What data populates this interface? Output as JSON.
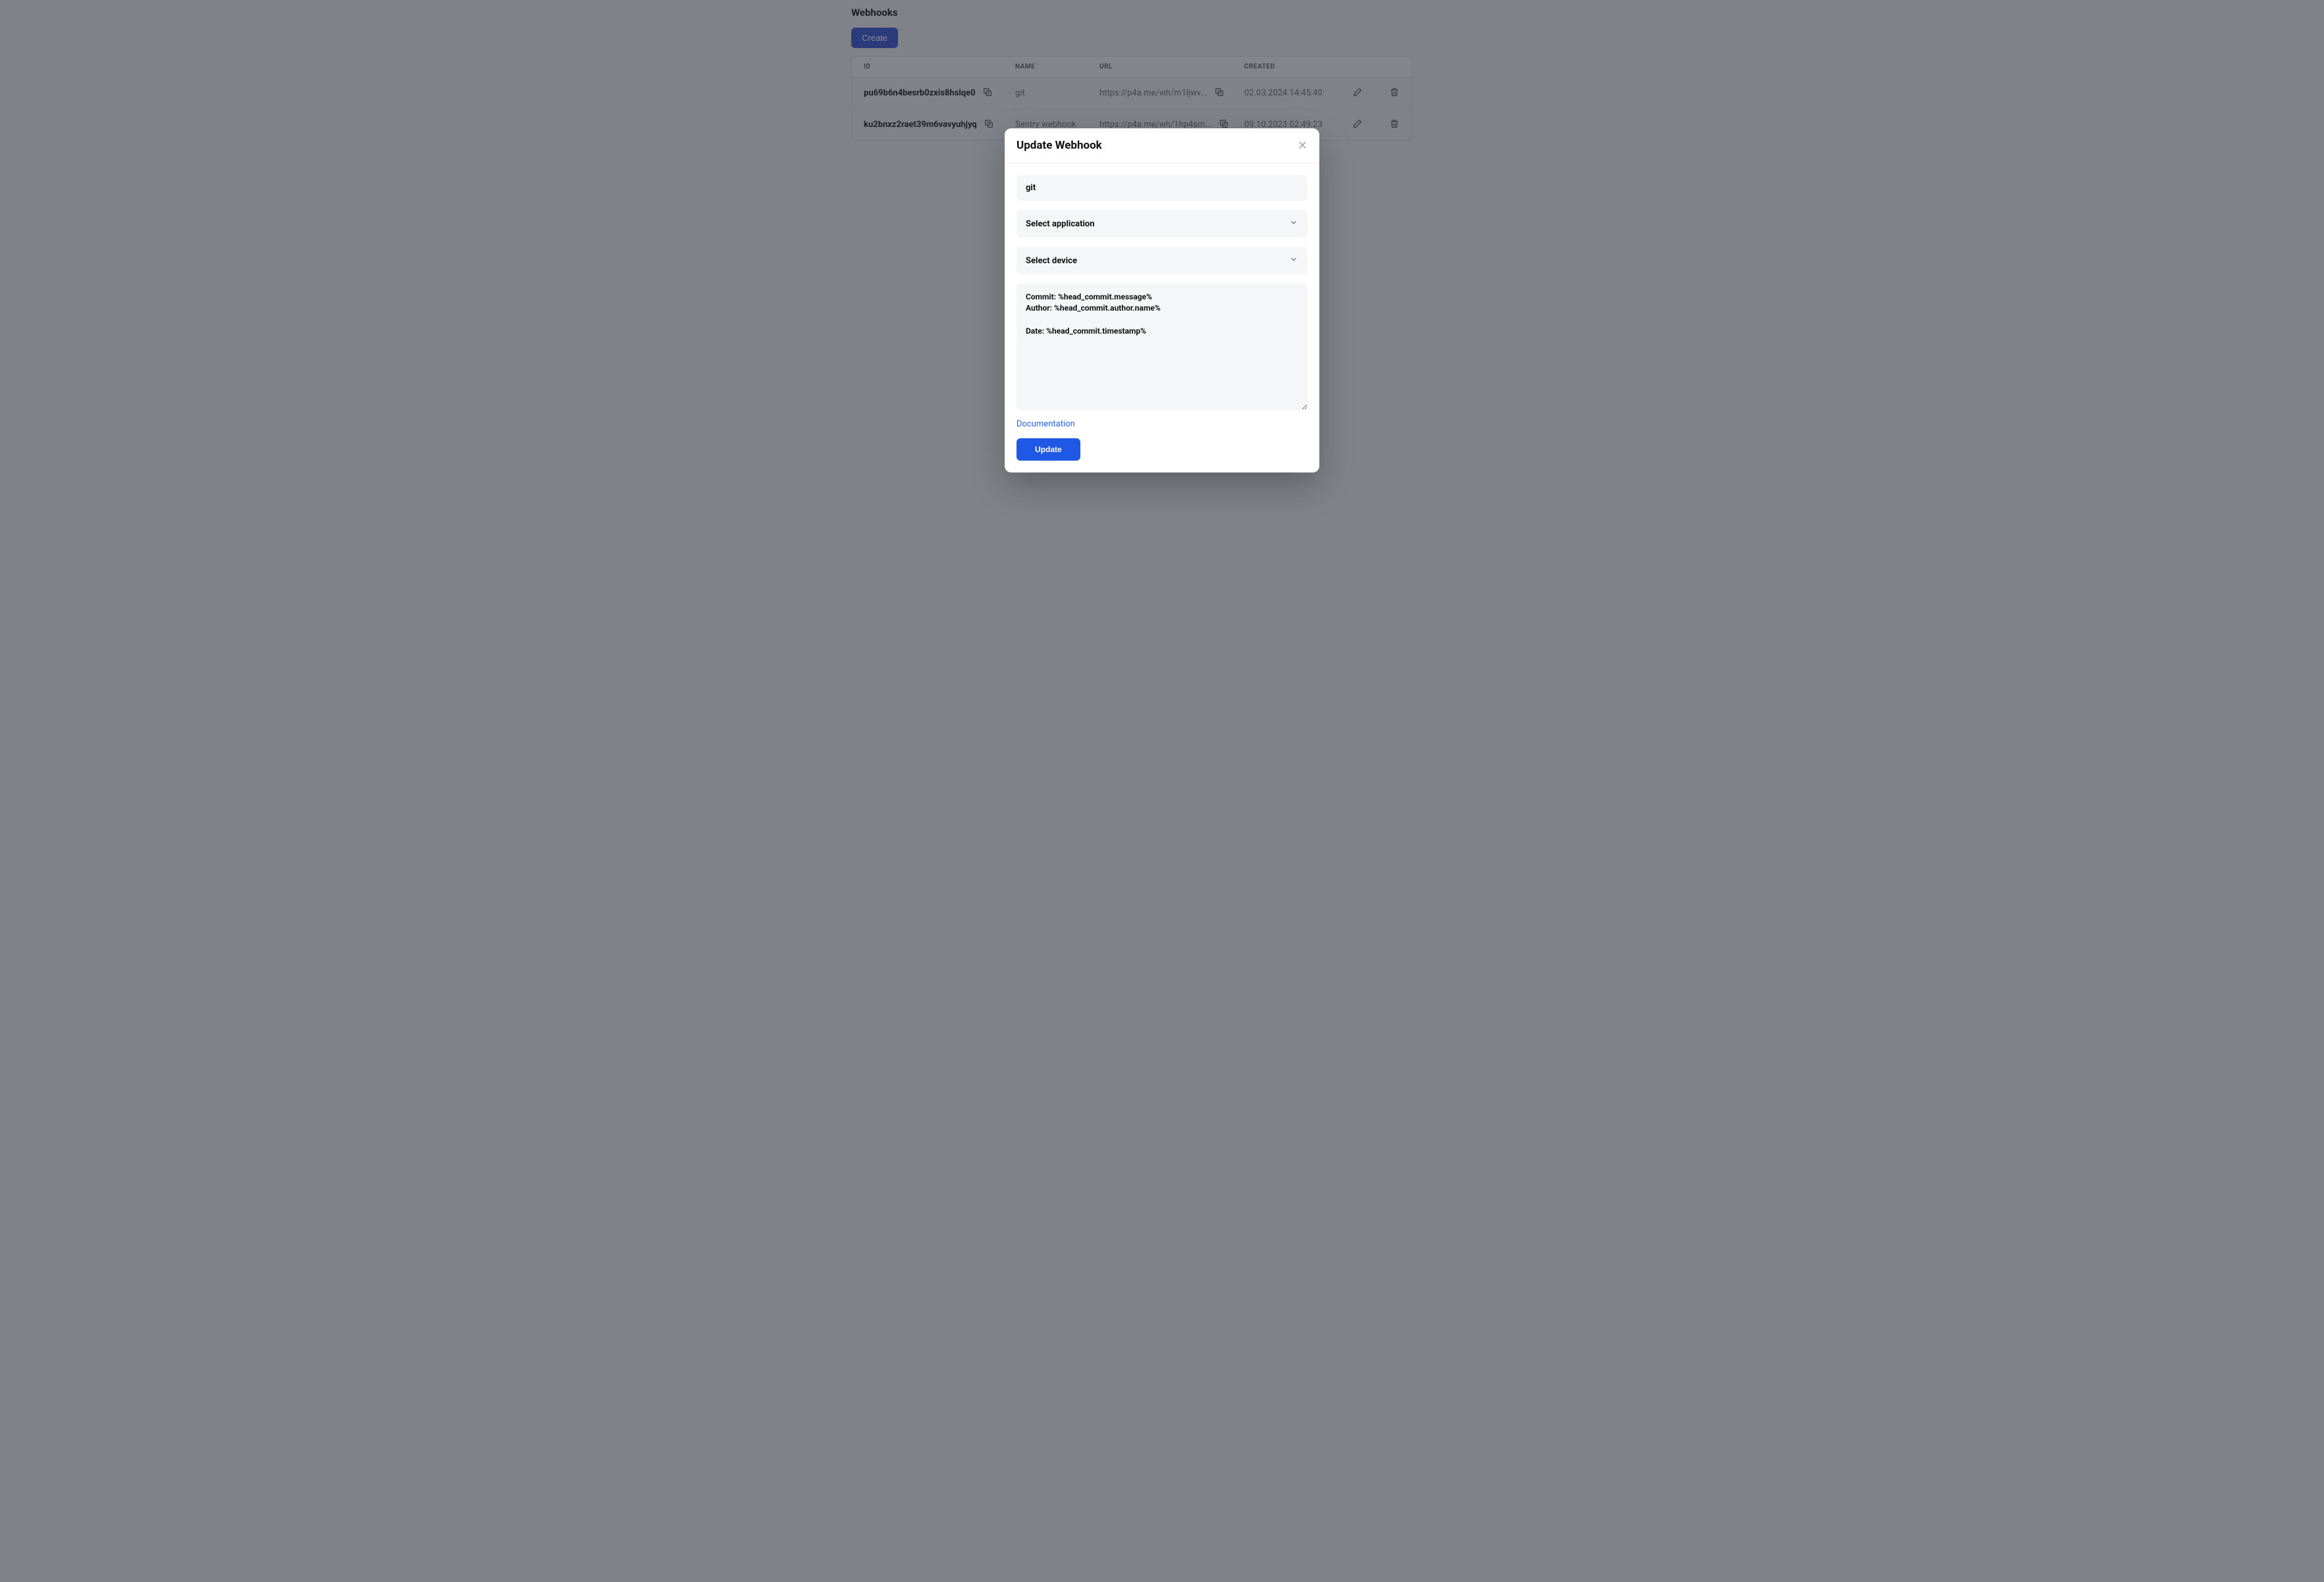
{
  "page": {
    "title": "Webhooks",
    "create_label": "Create"
  },
  "table": {
    "headers": {
      "id": "ID",
      "name": "NAME",
      "url": "URL",
      "created": "CREATED"
    },
    "rows": [
      {
        "id": "pu69b6n4besrb0zxis8hslqe0",
        "name": "git",
        "url": "https://p4a.me/wh/m1ljwv...",
        "created": "02.03.2024 14:45:40"
      },
      {
        "id": "ku2bnxz2raet39m6vavyuhjyq",
        "name": "Sentry webhook",
        "url": "https://p4a.me/wh/1hp4sm...",
        "created": "09.10.2023 02:49:23"
      }
    ]
  },
  "modal": {
    "title": "Update Webhook",
    "name_value": "git",
    "select_app": "Select application",
    "select_device": "Select device",
    "textarea_value": "Commit: %head_commit.message%\nAuthor: %head_commit.author.name%\n\nDate: %head_commit.timestamp%",
    "doc_link": "Documentation",
    "update_label": "Update"
  }
}
